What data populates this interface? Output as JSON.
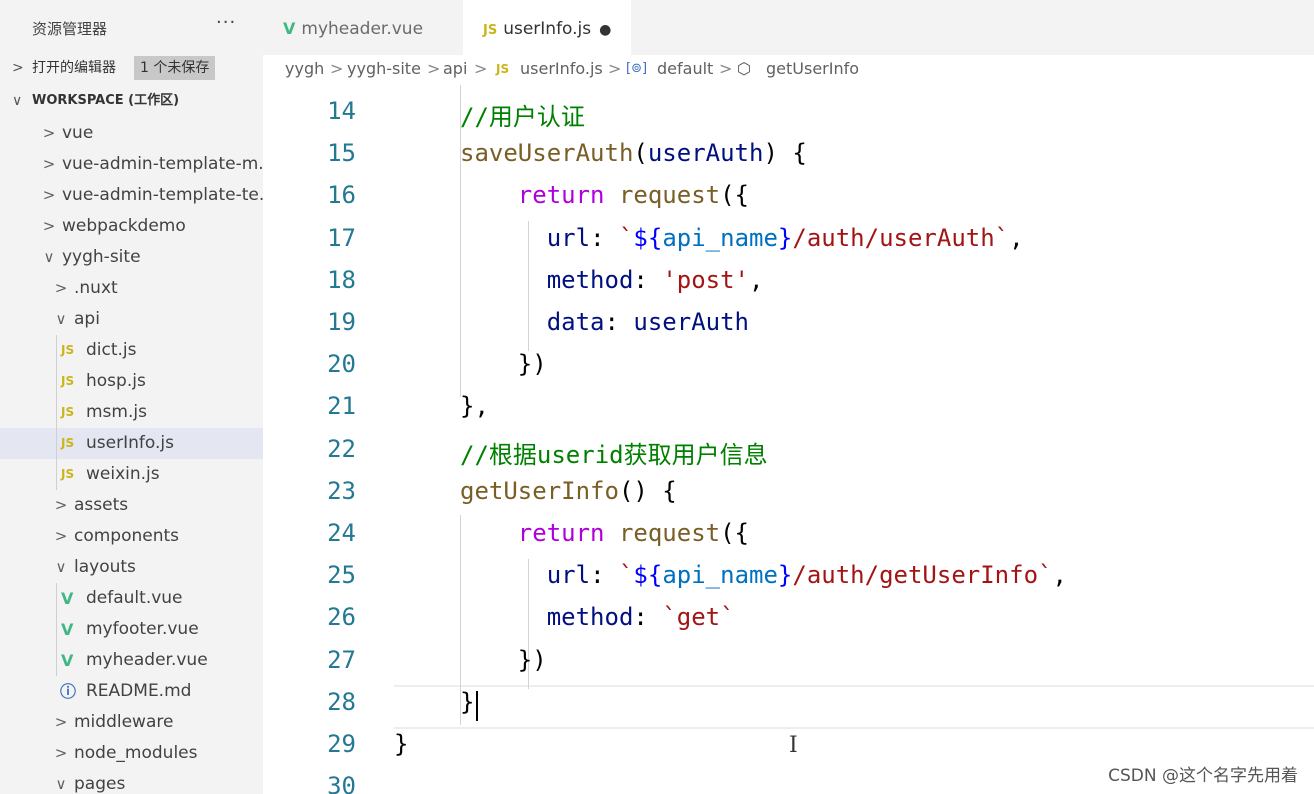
{
  "sidebar": {
    "title": "资源管理器",
    "more": "···",
    "open_editors": {
      "label": "打开的编辑器",
      "badge": "1 个未保存"
    },
    "workspace": {
      "label": "WORKSPACE (工作区)"
    },
    "tree": [
      {
        "label": "vue",
        "type": "folder",
        "expanded": false,
        "depth": 0
      },
      {
        "label": "vue-admin-template-m...",
        "type": "folder",
        "expanded": false,
        "depth": 0
      },
      {
        "label": "vue-admin-template-te...",
        "type": "folder",
        "expanded": false,
        "depth": 0
      },
      {
        "label": "webpackdemo",
        "type": "folder",
        "expanded": false,
        "depth": 0
      },
      {
        "label": "yygh-site",
        "type": "folder",
        "expanded": true,
        "depth": 0
      },
      {
        "label": ".nuxt",
        "type": "folder",
        "expanded": false,
        "depth": 1
      },
      {
        "label": "api",
        "type": "folder",
        "expanded": true,
        "depth": 1
      },
      {
        "label": "dict.js",
        "type": "js",
        "depth": 2
      },
      {
        "label": "hosp.js",
        "type": "js",
        "depth": 2
      },
      {
        "label": "msm.js",
        "type": "js",
        "depth": 2
      },
      {
        "label": "userInfo.js",
        "type": "js",
        "depth": 2,
        "selected": true
      },
      {
        "label": "weixin.js",
        "type": "js",
        "depth": 2
      },
      {
        "label": "assets",
        "type": "folder",
        "expanded": false,
        "depth": 1
      },
      {
        "label": "components",
        "type": "folder",
        "expanded": false,
        "depth": 1
      },
      {
        "label": "layouts",
        "type": "folder",
        "expanded": true,
        "depth": 1
      },
      {
        "label": "default.vue",
        "type": "vue",
        "depth": 2
      },
      {
        "label": "myfooter.vue",
        "type": "vue",
        "depth": 2
      },
      {
        "label": "myheader.vue",
        "type": "vue",
        "depth": 2
      },
      {
        "label": "README.md",
        "type": "info",
        "depth": 1
      },
      {
        "label": "middleware",
        "type": "folder",
        "expanded": false,
        "depth": 1
      },
      {
        "label": "node_modules",
        "type": "folder",
        "expanded": false,
        "depth": 1
      },
      {
        "label": "pages",
        "type": "folder",
        "expanded": true,
        "depth": 1
      }
    ]
  },
  "tabs": [
    {
      "icon": "V",
      "label": "myheader.vue",
      "active": false
    },
    {
      "icon": "JS",
      "label": "userInfo.js",
      "active": true,
      "dirty": "●"
    }
  ],
  "breadcrumb": {
    "parts": [
      "yygh",
      "yygh-site",
      "api",
      "userInfo.js",
      "default",
      "getUserInfo"
    ],
    "js_icon": "JS",
    "sep": ">"
  },
  "editor": {
    "line_numbers": [
      "14",
      "15",
      "16",
      "17",
      "18",
      "19",
      "20",
      "21",
      "22",
      "23",
      "24",
      "25",
      "26",
      "27",
      "28",
      "29",
      "30"
    ],
    "lines": [
      [
        {
          "t": "//用户认证",
          "c": "c-comment"
        }
      ],
      [
        {
          "t": "saveUserAuth",
          "c": "c-fn"
        },
        {
          "t": "(",
          "c": ""
        },
        {
          "t": "userAuth",
          "c": "c-param"
        },
        {
          "t": ") {",
          "c": ""
        }
      ],
      [
        {
          "t": "    ",
          "c": ""
        },
        {
          "t": "return",
          "c": "c-kw"
        },
        {
          "t": " ",
          "c": ""
        },
        {
          "t": "request",
          "c": "c-fn"
        },
        {
          "t": "({",
          "c": ""
        }
      ],
      [
        {
          "t": "      ",
          "c": ""
        },
        {
          "t": "url",
          "c": "c-param"
        },
        {
          "t": ": ",
          "c": ""
        },
        {
          "t": "`",
          "c": "c-str"
        },
        {
          "t": "${",
          "c": "c-tmpl"
        },
        {
          "t": "api_name",
          "c": "c-var"
        },
        {
          "t": "}",
          "c": "c-tmpl"
        },
        {
          "t": "/auth/userAuth`",
          "c": "c-str"
        },
        {
          "t": ",",
          "c": ""
        }
      ],
      [
        {
          "t": "      ",
          "c": ""
        },
        {
          "t": "method",
          "c": "c-param"
        },
        {
          "t": ": ",
          "c": ""
        },
        {
          "t": "'post'",
          "c": "c-str"
        },
        {
          "t": ",",
          "c": ""
        }
      ],
      [
        {
          "t": "      ",
          "c": ""
        },
        {
          "t": "data",
          "c": "c-param"
        },
        {
          "t": ": ",
          "c": ""
        },
        {
          "t": "userAuth",
          "c": "c-param"
        }
      ],
      [
        {
          "t": "    })",
          "c": ""
        }
      ],
      [
        {
          "t": "},",
          "c": ""
        }
      ],
      [
        {
          "t": "//根据userid获取用户信息",
          "c": "c-comment"
        }
      ],
      [
        {
          "t": "getUserInfo",
          "c": "c-fn"
        },
        {
          "t": "() {",
          "c": ""
        }
      ],
      [
        {
          "t": "    ",
          "c": ""
        },
        {
          "t": "return",
          "c": "c-kw"
        },
        {
          "t": " ",
          "c": ""
        },
        {
          "t": "request",
          "c": "c-fn"
        },
        {
          "t": "({",
          "c": ""
        }
      ],
      [
        {
          "t": "      ",
          "c": ""
        },
        {
          "t": "url",
          "c": "c-param"
        },
        {
          "t": ": ",
          "c": ""
        },
        {
          "t": "`",
          "c": "c-str"
        },
        {
          "t": "${",
          "c": "c-tmpl"
        },
        {
          "t": "api_name",
          "c": "c-var"
        },
        {
          "t": "}",
          "c": "c-tmpl"
        },
        {
          "t": "/auth/getUserInfo`",
          "c": "c-str"
        },
        {
          "t": ",",
          "c": ""
        }
      ],
      [
        {
          "t": "      ",
          "c": ""
        },
        {
          "t": "method",
          "c": "c-param"
        },
        {
          "t": ": ",
          "c": ""
        },
        {
          "t": "`get`",
          "c": "c-str"
        }
      ],
      [
        {
          "t": "    })",
          "c": ""
        }
      ],
      [
        {
          "t": "}",
          "c": ""
        }
      ],
      [
        {
          "t": "}",
          "c": ""
        }
      ],
      [
        {
          "t": "",
          "c": ""
        }
      ]
    ]
  },
  "watermark": "CSDN @这个名字先用着",
  "colors": {
    "accent_js": "#cbb51c",
    "accent_vue": "#41b883",
    "line_number": "#237893"
  }
}
